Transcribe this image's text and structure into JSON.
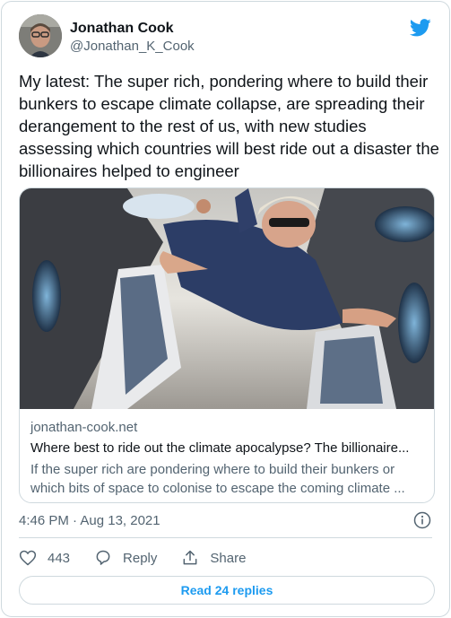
{
  "author": {
    "name": "Jonathan Cook",
    "handle": "@Jonathan_K_Cook"
  },
  "tweet": {
    "text": "My latest: The super rich, pondering where to build their bunkers to escape climate collapse, are spreading their derangement to the rest of us, with new studies assessing which countries will best ride out a disaster the billionaires helped to engineer"
  },
  "card": {
    "domain": "jonathan-cook.net",
    "title": "Where best to ride out the climate apocalypse? The billionaire...",
    "description": "If the super rich are pondering where to build their bunkers or which bits of space to colonise to escape the coming climate ..."
  },
  "timestamp": "4:46 PM · Aug 13, 2021",
  "actions": {
    "likes": "443",
    "reply_label": "Reply",
    "share_label": "Share"
  },
  "read_replies": "Read 24 replies",
  "colors": {
    "accent": "#1d9bf0",
    "secondary_text": "#536471",
    "border": "#cfd9de"
  },
  "icons": [
    "twitter-bird-icon",
    "heart-icon",
    "reply-icon",
    "share-icon",
    "info-icon"
  ]
}
